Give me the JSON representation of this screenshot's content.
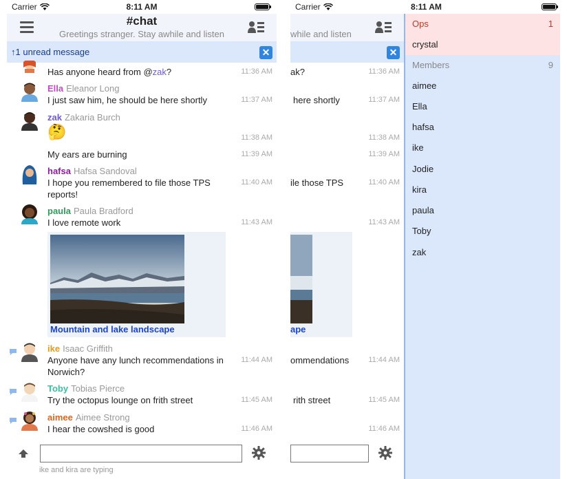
{
  "status": {
    "carrier": "Carrier",
    "time": "8:11 AM"
  },
  "header": {
    "title": "#chat",
    "topic": "Greetings stranger. Stay awhile and listen"
  },
  "unread": {
    "text": "↑1 unread message",
    "close": "✕"
  },
  "messages": [
    {
      "prefix": "Has anyone heard from @",
      "mention": "zak",
      "suffix": "?",
      "time": "11:36 AM"
    },
    {
      "nick": "Ella",
      "realname": "Eleanor Long",
      "text": "I just saw him, he should be here shortly",
      "time": "11:37 AM",
      "nick_color": "#c34bc1"
    },
    {
      "nick": "zak",
      "realname": "Zakaria Burch",
      "text": "🤔",
      "time": "11:38 AM",
      "nick_color": "#6f5ad6"
    },
    {
      "text": "My ears are burning",
      "time": "11:39 AM"
    },
    {
      "nick": "hafsa",
      "realname": "Hafsa Sandoval",
      "text": "I hope you remembered to file those TPS reports!",
      "time": "11:40 AM",
      "nick_color": "#8a1d9c"
    },
    {
      "nick": "paula",
      "realname": "Paula Bradford",
      "text": "I love remote work",
      "time": "11:43 AM",
      "nick_color": "#2e9c5a"
    },
    {
      "image_caption": "Mountain and lake landscape"
    },
    {
      "nick": "ike",
      "realname": "Isaac Griffith",
      "text": "Anyone have any lunch recommendations in Norwich?",
      "time": "11:44 AM",
      "nick_color": "#e59a1c"
    },
    {
      "nick": "Toby",
      "realname": "Tobias Pierce",
      "text": "Try the octopus lounge on frith street",
      "time": "11:45 AM",
      "nick_color": "#3bbfa0"
    },
    {
      "nick": "aimee",
      "realname": "Aimee Strong",
      "text": "I hear the cowshed is good",
      "time": "11:46 AM",
      "nick_color": "#e0641c"
    }
  ],
  "screen2_snippets": {
    "m0": "ak?",
    "m1": "here shortly",
    "m4": "ile those TPS",
    "m7": "ommendations",
    "m8": "rith street",
    "caption": "ape",
    "topic": "while and listen"
  },
  "composer": {
    "value": "",
    "typing": "ike and kira are typing"
  },
  "drawer": {
    "ops_label": "Ops",
    "ops_count": "1",
    "ops": [
      "crystal"
    ],
    "members_label": "Members",
    "members_count": "9",
    "members": [
      "aimee",
      "Ella",
      "hafsa",
      "ike",
      "Jodie",
      "kira",
      "paula",
      "Toby",
      "zak"
    ]
  },
  "colors": {
    "accent": "#2e86de",
    "drawer_bg": "#dbe8fb",
    "ops_bg": "#fde3e3",
    "ops_text": "#c0392b"
  }
}
